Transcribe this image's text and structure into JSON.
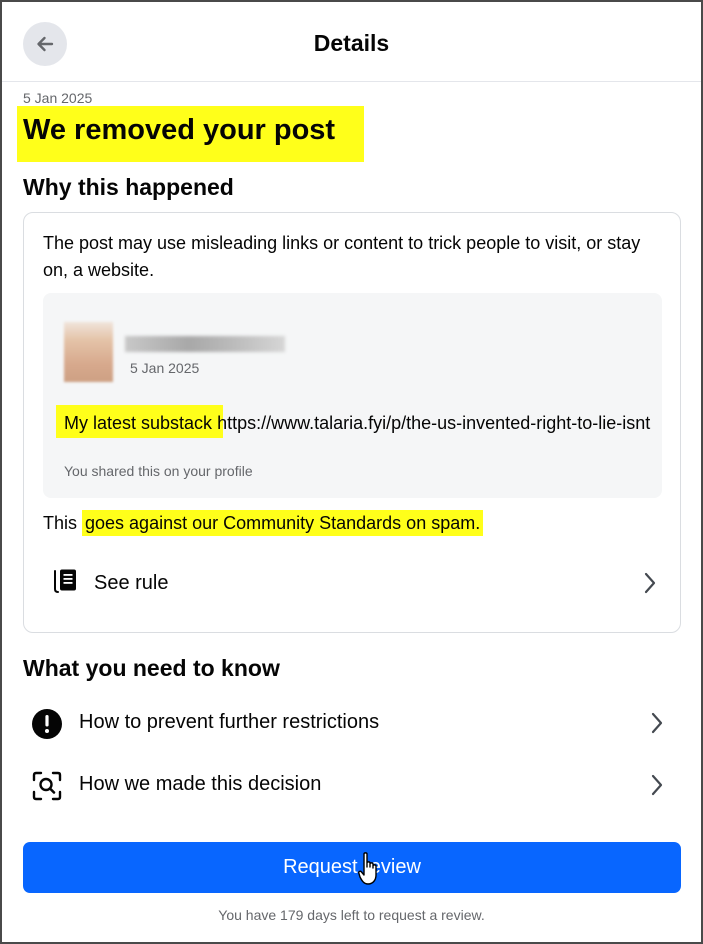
{
  "header": {
    "title": "Details",
    "back_icon": "arrow-left-icon"
  },
  "notice": {
    "date": "5 Jan 2025",
    "title": "We removed your post",
    "highlight_color": "#ffff1a"
  },
  "why": {
    "heading": "Why this happened",
    "description": "The post may use misleading links or content to trick people to visit, or stay on, a website.",
    "post": {
      "date": "5 Jan 2025",
      "text_highlighted": "My latest substack",
      "text_link": " https://www.talaria.fyi/p/the-us-invented-right-to-lie-isnt",
      "caption": "You shared this on your profile"
    },
    "rule_prefix": "This ",
    "rule_highlighted": "goes against our Community Standards on spam.",
    "see_rule": {
      "label": "See rule",
      "icon": "book-icon"
    }
  },
  "need_to_know": {
    "heading": "What you need to know",
    "items": [
      {
        "label": "How to prevent further restrictions",
        "icon": "exclamation-circle-icon"
      },
      {
        "label": "How we made this decision",
        "icon": "search-frame-icon"
      }
    ]
  },
  "request": {
    "button_label": "Request review",
    "note": "You have 179 days left to request a review.",
    "accent_color": "#0866ff"
  }
}
